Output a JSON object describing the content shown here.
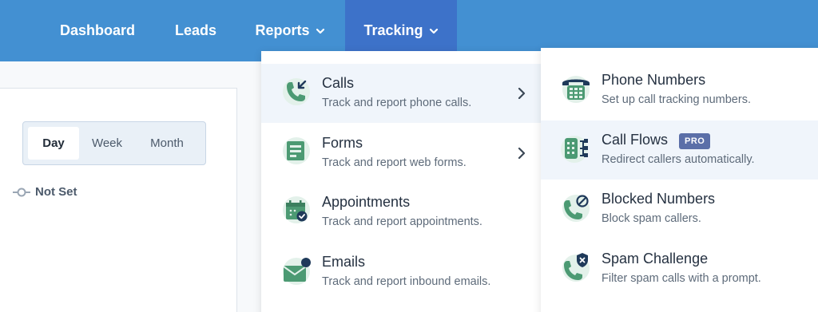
{
  "nav": {
    "items": [
      {
        "label": "Dashboard"
      },
      {
        "label": "Leads"
      },
      {
        "label": "Reports"
      },
      {
        "label": "Tracking"
      }
    ]
  },
  "filters": {
    "segments": [
      "Day",
      "Week",
      "Month"
    ],
    "selected": "Day",
    "legend_label": "Not Set"
  },
  "tracking_menu": {
    "items": [
      {
        "title": "Calls",
        "desc": "Track and report phone calls.",
        "icon": "phone-incoming-icon"
      },
      {
        "title": "Forms",
        "desc": "Track and report web forms.",
        "icon": "form-icon"
      },
      {
        "title": "Appointments",
        "desc": "Track and report appointments.",
        "icon": "calendar-check-icon"
      },
      {
        "title": "Emails",
        "desc": "Track and report inbound emails.",
        "icon": "envelope-icon"
      }
    ]
  },
  "calls_submenu": {
    "items": [
      {
        "title": "Phone Numbers",
        "desc": "Set up call tracking numbers.",
        "icon": "desk-phone-icon"
      },
      {
        "title": "Call Flows",
        "desc": "Redirect callers automatically.",
        "badge": "PRO",
        "icon": "call-flow-icon"
      },
      {
        "title": "Blocked Numbers",
        "desc": "Block spam callers.",
        "icon": "phone-blocked-icon"
      },
      {
        "title": "Spam Challenge",
        "desc": "Filter spam calls with a prompt.",
        "icon": "phone-shield-icon"
      }
    ]
  },
  "colors": {
    "nav_bg": "#4390d2",
    "nav_active": "#3d72c9",
    "icon_green": "#4c9a73",
    "badge": "#5b6fa8"
  }
}
